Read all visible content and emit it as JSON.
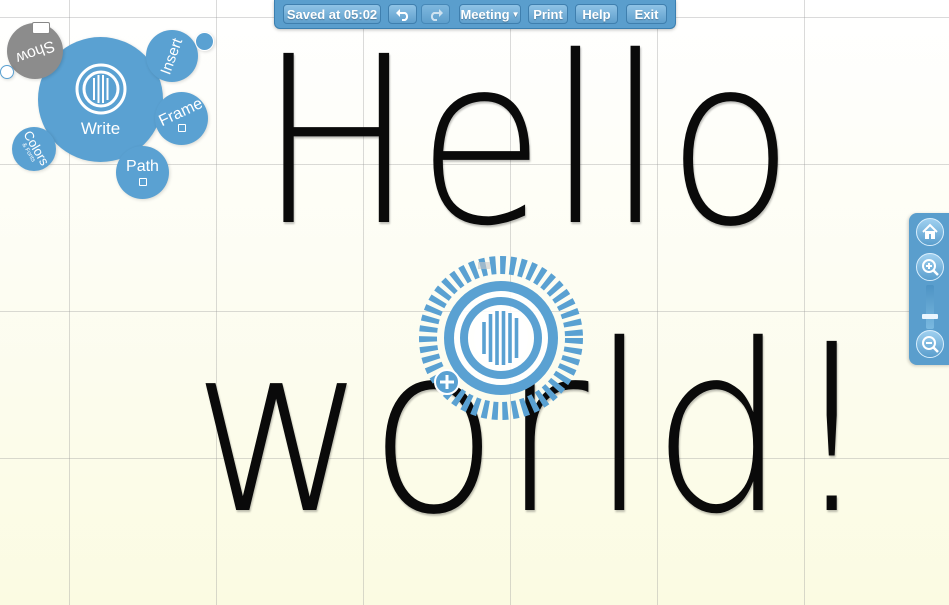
{
  "toolbar": {
    "saved_label": "Saved at 05:02",
    "undo_icon": "undo-icon",
    "redo_icon": "redo-icon",
    "meeting_label": "Meeting",
    "print_label": "Print",
    "help_label": "Help",
    "exit_label": "Exit"
  },
  "canvas": {
    "line1": "Hello",
    "line2": "world!"
  },
  "bubble_menu": {
    "center_label": "Write",
    "items": {
      "show": "Show",
      "insert": "Insert",
      "frame": "Frame",
      "path": "Path",
      "colors": "Colors",
      "colors_sub": "& Fonts"
    }
  },
  "zoom": {
    "home_icon": "home-icon",
    "zoom_in_icon": "zoom-in-icon",
    "zoom_out_icon": "zoom-out-icon"
  },
  "colors": {
    "accent": "#5aa1d2",
    "toolbar": "#5a9ecd",
    "text": "#0a0a0a"
  }
}
